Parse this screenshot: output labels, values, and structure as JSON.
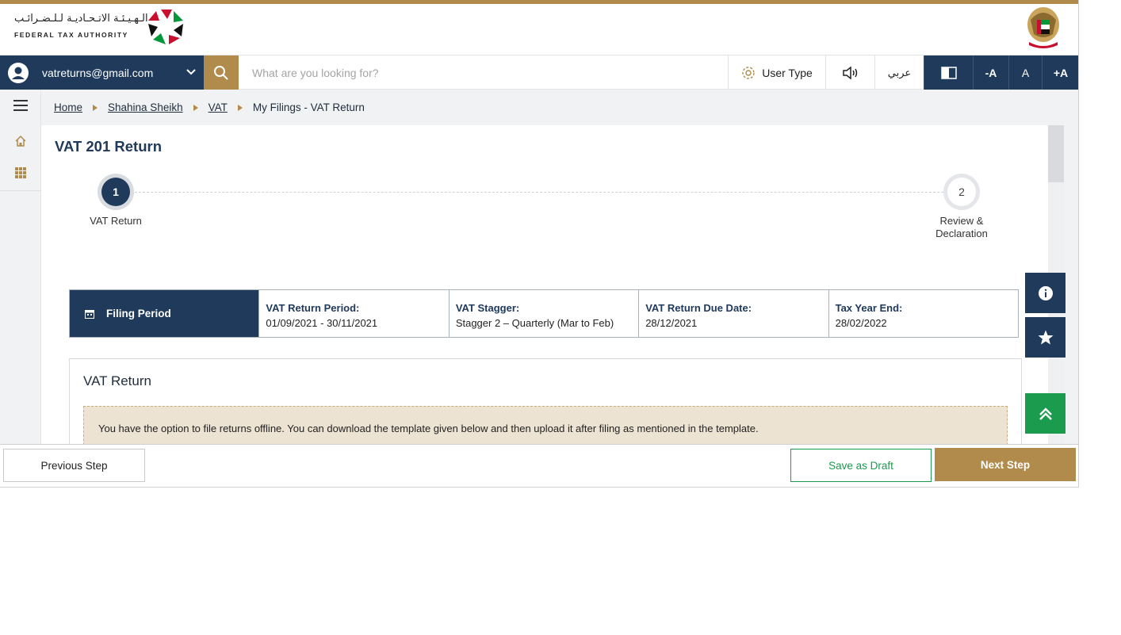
{
  "header": {
    "logo_arabic": "الـهـيـئـة الاتـحـاديـة لـلـضـرائـب",
    "logo_english": "FEDERAL TAX AUTHORITY"
  },
  "nav": {
    "user_email": "vatreturns@gmail.com",
    "search_placeholder": "What are you looking for?",
    "user_type_label": "User Type",
    "language_label": "عربي",
    "font_decrease": "-A",
    "font_normal": "A",
    "font_increase": "+A"
  },
  "breadcrumb": {
    "items": [
      "Home",
      "Shahina Sheikh",
      "VAT"
    ],
    "current": "My Filings - VAT Return"
  },
  "page": {
    "title": "VAT 201 Return",
    "steps": [
      {
        "number": "1",
        "label": "VAT Return",
        "state": "active"
      },
      {
        "number": "2",
        "label": "Review & Declaration",
        "state": "pending"
      }
    ]
  },
  "filing_period": {
    "heading": "Filing Period",
    "cells": [
      {
        "label": "VAT Return Period:",
        "value": "01/09/2021 - 30/11/2021"
      },
      {
        "label": "VAT Stagger:",
        "value": "Stagger 2 – Quarterly (Mar to Feb)"
      },
      {
        "label": "VAT Return Due Date:",
        "value": "28/12/2021"
      },
      {
        "label": "Tax Year End:",
        "value": "28/02/2022"
      }
    ]
  },
  "vat_return": {
    "title": "VAT Return",
    "notice": "You have the option to file returns offline. You can download the template given below and then upload it after filing as mentioned in the template."
  },
  "footer": {
    "previous_label": "Previous Step",
    "draft_label": "Save as Draft",
    "next_label": "Next Step"
  },
  "colors": {
    "navy": "#203a5b",
    "gold": "#b18b4b",
    "green": "#1a9b4e",
    "notice_bg": "#ede3d3"
  },
  "icons": {
    "user": "user-circle-icon",
    "chevron": "chevron-down-icon",
    "search": "search-icon",
    "user_type": "gear-icon",
    "speaker": "speaker-icon",
    "contrast": "contrast-icon",
    "menu": "hamburger-menu-icon",
    "home": "home-icon",
    "apps": "grid-icon",
    "calendar": "calendar-icon",
    "info": "info-icon",
    "star": "star-icon",
    "scroll_top": "double-chevron-up-icon"
  }
}
